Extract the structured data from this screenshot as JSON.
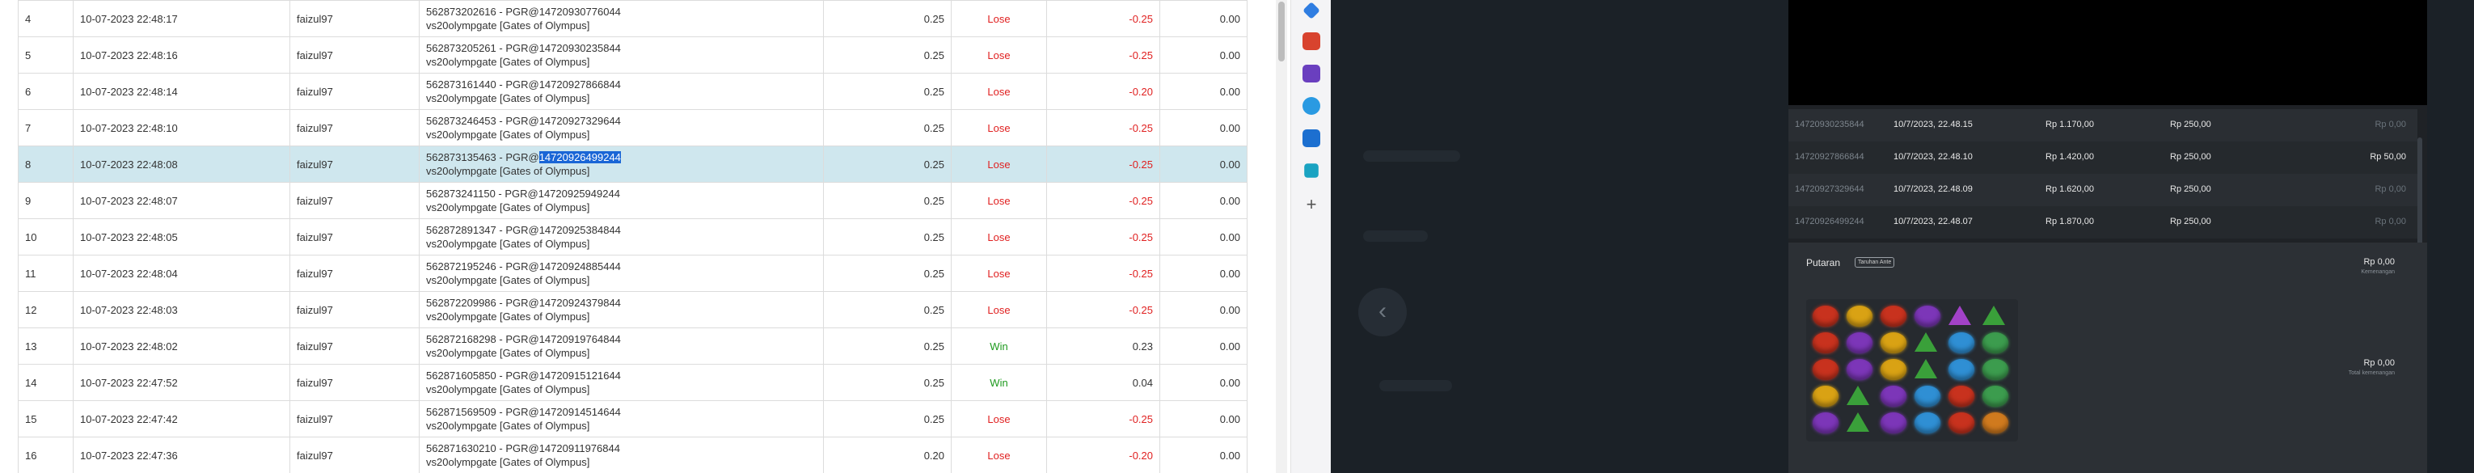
{
  "table": {
    "rows": [
      {
        "no": "4",
        "datetime": "10-07-2023 22:48:17",
        "user": "faizul97",
        "tx_prefix": "562873202616 - PGR@",
        "tx_hash": "14720930776044",
        "game": "vs20olympgate [Gates of Olympus]",
        "bet": "0.25",
        "result": "Lose",
        "winlose": "-0.25",
        "balance": "0.00"
      },
      {
        "no": "5",
        "datetime": "10-07-2023 22:48:16",
        "user": "faizul97",
        "tx_prefix": "562873205261 - PGR@",
        "tx_hash": "14720930235844",
        "game": "vs20olympgate [Gates of Olympus]",
        "bet": "0.25",
        "result": "Lose",
        "winlose": "-0.25",
        "balance": "0.00"
      },
      {
        "no": "6",
        "datetime": "10-07-2023 22:48:14",
        "user": "faizul97",
        "tx_prefix": "562873161440 - PGR@",
        "tx_hash": "14720927866844",
        "game": "vs20olympgate [Gates of Olympus]",
        "bet": "0.25",
        "result": "Lose",
        "winlose": "-0.20",
        "balance": "0.00"
      },
      {
        "no": "7",
        "datetime": "10-07-2023 22:48:10",
        "user": "faizul97",
        "tx_prefix": "562873246453 - PGR@",
        "tx_hash": "14720927329644",
        "game": "vs20olympgate [Gates of Olympus]",
        "bet": "0.25",
        "result": "Lose",
        "winlose": "-0.25",
        "balance": "0.00"
      },
      {
        "no": "8",
        "datetime": "10-07-2023 22:48:08",
        "user": "faizul97",
        "tx_prefix": "562873135463 - PGR@",
        "tx_hash": "14720926499244",
        "game": "vs20olympgate [Gates of Olympus]",
        "bet": "0.25",
        "result": "Lose",
        "winlose": "-0.25",
        "balance": "0.00",
        "selected": true
      },
      {
        "no": "9",
        "datetime": "10-07-2023 22:48:07",
        "user": "faizul97",
        "tx_prefix": "562873241150 - PGR@",
        "tx_hash": "14720925949244",
        "game": "vs20olympgate [Gates of Olympus]",
        "bet": "0.25",
        "result": "Lose",
        "winlose": "-0.25",
        "balance": "0.00"
      },
      {
        "no": "10",
        "datetime": "10-07-2023 22:48:05",
        "user": "faizul97",
        "tx_prefix": "562872891347 - PGR@",
        "tx_hash": "14720925384844",
        "game": "vs20olympgate [Gates of Olympus]",
        "bet": "0.25",
        "result": "Lose",
        "winlose": "-0.25",
        "balance": "0.00"
      },
      {
        "no": "11",
        "datetime": "10-07-2023 22:48:04",
        "user": "faizul97",
        "tx_prefix": "562872195246 - PGR@",
        "tx_hash": "14720924885444",
        "game": "vs20olympgate [Gates of Olympus]",
        "bet": "0.25",
        "result": "Lose",
        "winlose": "-0.25",
        "balance": "0.00"
      },
      {
        "no": "12",
        "datetime": "10-07-2023 22:48:03",
        "user": "faizul97",
        "tx_prefix": "562872209986 - PGR@",
        "tx_hash": "14720924379844",
        "game": "vs20olympgate [Gates of Olympus]",
        "bet": "0.25",
        "result": "Lose",
        "winlose": "-0.25",
        "balance": "0.00"
      },
      {
        "no": "13",
        "datetime": "10-07-2023 22:48:02",
        "user": "faizul97",
        "tx_prefix": "562872168298 - PGR@",
        "tx_hash": "14720919764844",
        "game": "vs20olympgate [Gates of Olympus]",
        "bet": "0.25",
        "result": "Win",
        "winlose": "0.23",
        "balance": "0.00"
      },
      {
        "no": "14",
        "datetime": "10-07-2023 22:47:52",
        "user": "faizul97",
        "tx_prefix": "562871605850 - PGR@",
        "tx_hash": "14720915121644",
        "game": "vs20olympgate [Gates of Olympus]",
        "bet": "0.25",
        "result": "Win",
        "winlose": "0.04",
        "balance": "0.00"
      },
      {
        "no": "15",
        "datetime": "10-07-2023 22:47:42",
        "user": "faizul97",
        "tx_prefix": "562871569509 - PGR@",
        "tx_hash": "14720914514644",
        "game": "vs20olympgate [Gates of Olympus]",
        "bet": "0.25",
        "result": "Lose",
        "winlose": "-0.25",
        "balance": "0.00"
      },
      {
        "no": "16",
        "datetime": "10-07-2023 22:47:36",
        "user": "faizul97",
        "tx_prefix": "562871630210 - PGR@",
        "tx_hash": "14720911976844",
        "game": "vs20olympgate [Gates of Olympus]",
        "bet": "0.20",
        "result": "Lose",
        "winlose": "-0.20",
        "balance": "0.00"
      }
    ]
  },
  "sidebar": {
    "icons": [
      "tag-icon",
      "briefcase-icon",
      "user-chess-icon",
      "circle-app-icon",
      "outlook-icon",
      "shopping-cart-icon",
      "add-icon"
    ],
    "add_glyph": "+"
  },
  "history": {
    "rows": [
      {
        "id": "14720930235844",
        "time": "10/7/2023, 22.48.15",
        "col1": "Rp 1.170,00",
        "col2": "Rp 250,00",
        "right": "Rp 0,00"
      },
      {
        "id": "14720927866844",
        "time": "10/7/2023, 22.48.10",
        "col1": "Rp 1.420,00",
        "col2": "Rp 250,00",
        "right": "Rp 50,00"
      },
      {
        "id": "14720927329644",
        "time": "10/7/2023, 22.48.09",
        "col1": "Rp 1.620,00",
        "col2": "Rp 250,00",
        "right": "Rp 0,00"
      },
      {
        "id": "14720926499244",
        "time": "10/7/2023, 22.48.07",
        "col1": "Rp 1.870,00",
        "col2": "Rp 250,00",
        "right": "Rp 0,00"
      }
    ]
  },
  "detail": {
    "title": "Putaran",
    "badge": "Taruhan Ante",
    "amount_top": "Rp 0,00",
    "amount_top_caption": "Kemenangan",
    "amount_bottom": "Rp 0,00",
    "amount_bottom_caption": "Total kemenangan"
  },
  "back_glyph": "‹",
  "gem_grid": [
    [
      "red-gem",
      "yellow-gem",
      "red-gem",
      "purple-gem",
      "purple-triangle",
      "green-triangle"
    ],
    [
      "red-gem",
      "purple-gem",
      "yellow-gem",
      "green-triangle",
      "blue-gem",
      "green-gem"
    ],
    [
      "red-gem",
      "purple-gem",
      "yellow-gem",
      "green-triangle",
      "blue-gem",
      "green-gem"
    ],
    [
      "yellow-gem",
      "green-triangle",
      "purple-gem",
      "blue-gem",
      "red-gem",
      "green-gem"
    ],
    [
      "purple-gem",
      "green-triangle",
      "purple-gem",
      "blue-gem",
      "red-gem",
      "crown-gem"
    ]
  ],
  "colors": {
    "selected_row": "#cfe7ee",
    "lose": "#e02020",
    "win": "#1e9a1e",
    "highlight": "#1a66d6",
    "dark_bg": "#1b2127"
  }
}
